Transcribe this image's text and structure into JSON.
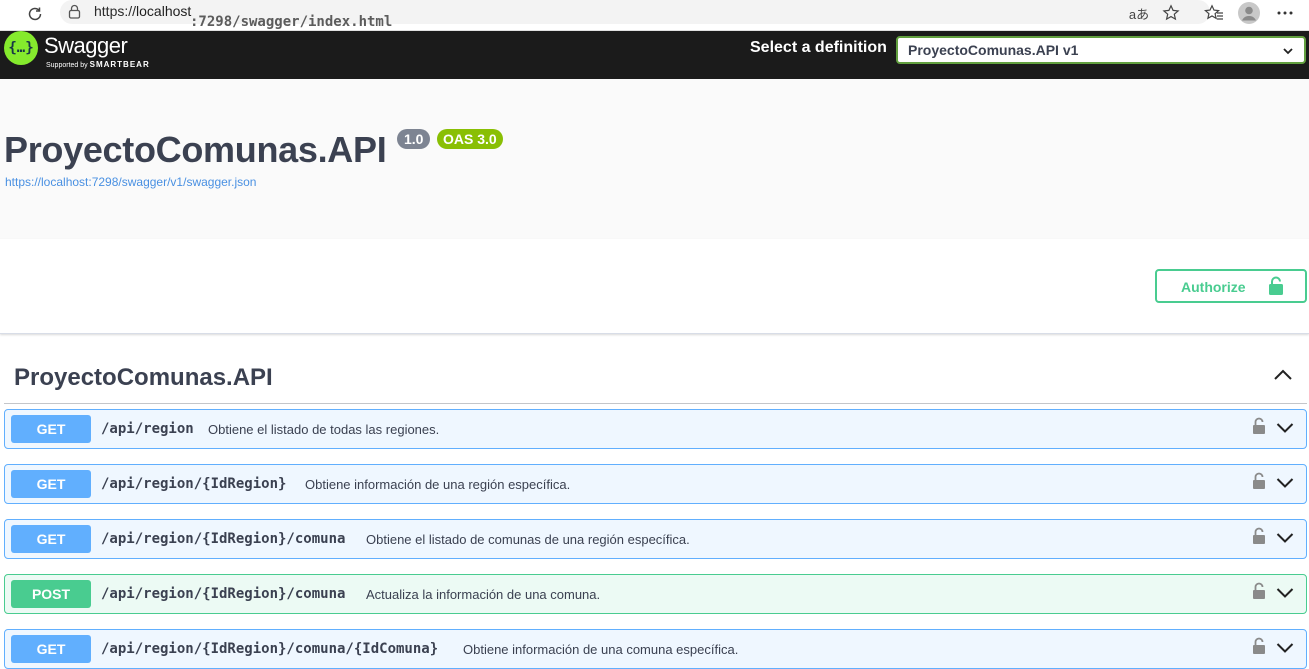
{
  "browser": {
    "url_scheme": "https://",
    "url_host": "localhost",
    "url_path": ":7298/swagger/index.html",
    "read_aloud_glyph": "aあ"
  },
  "topbar": {
    "logo_name": "Swagger",
    "logo_sub_prefix": "Supported by",
    "logo_sub_brand": "SMARTBEAR",
    "logo_glyph": "{…}",
    "select_label": "Select a definition",
    "selected_definition": "ProyectoComunas.API v1"
  },
  "info": {
    "title": "ProyectoComunas.API",
    "version": "1.0",
    "oas": "OAS 3.0",
    "spec_url": "https://localhost:7298/swagger/v1/swagger.json"
  },
  "scheme": {
    "authorize_label": "Authorize"
  },
  "tag": {
    "name": "ProyectoComunas.API"
  },
  "operations": [
    {
      "method": "GET",
      "path": "/api/region",
      "summary": "Obtiene el listado de todas las regiones."
    },
    {
      "method": "GET",
      "path": "/api/region/{IdRegion}",
      "summary": "Obtiene información de una región específica."
    },
    {
      "method": "GET",
      "path": "/api/region/{IdRegion}/comuna",
      "summary": "Obtiene el listado de comunas de una región específica."
    },
    {
      "method": "POST",
      "path": "/api/region/{IdRegion}/comuna",
      "summary": "Actualiza la información de una comuna."
    },
    {
      "method": "GET",
      "path": "/api/region/{IdRegion}/comuna/{IdComuna}",
      "summary": "Obtiene información de una comuna específica."
    }
  ],
  "colors": {
    "get": "#61affe",
    "post": "#49cc90",
    "swagger_green": "#85ea2d",
    "topbar_bg": "#1b1b1b"
  }
}
